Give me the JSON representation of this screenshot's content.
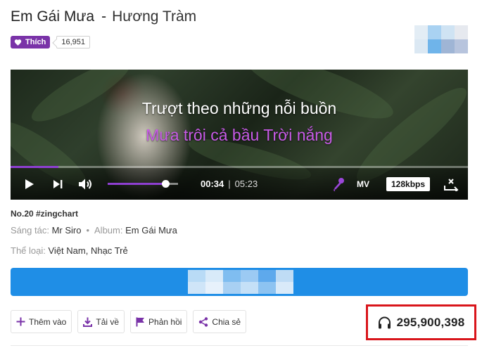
{
  "song": {
    "title": "Em Gái Mưa",
    "separator": "-",
    "artist": "Hương Tràm"
  },
  "like": {
    "label": "Thích",
    "count": "16,951"
  },
  "player": {
    "lyric_current": "Trượt theo những nỗi buồn",
    "lyric_next": "Mưa trôi cả bầu Trời nắng",
    "time_current": "00:34",
    "time_separator": "|",
    "time_total": "05:23",
    "progress_fraction": 0.105,
    "volume_fraction": 0.82,
    "mv_label": "MV",
    "quality_label": "128kbps",
    "accent_color": "#8e3fd1",
    "icons": [
      "play-icon",
      "next-icon",
      "volume-icon",
      "karaoke-mic-icon",
      "expand-icon"
    ]
  },
  "info": {
    "chart_rank": "No.20 #zingchart",
    "composer_label": "Sáng tác:",
    "composer": "Mr Siro",
    "album_label": "Album:",
    "album": "Em Gái Mưa",
    "genre_label": "Thể loại:",
    "genre": "Việt Nam, Nhạc Trẻ"
  },
  "primary_button_color": "#1f8ee6",
  "actions": {
    "add": "Thêm vào",
    "download": "Tải về",
    "report": "Phản hồi",
    "share": "Chia sẻ"
  },
  "listens": {
    "count": "295,900,398",
    "icon": "headphones-icon",
    "highlight_color": "#d9151b"
  },
  "brand_color": "#7a33a8"
}
